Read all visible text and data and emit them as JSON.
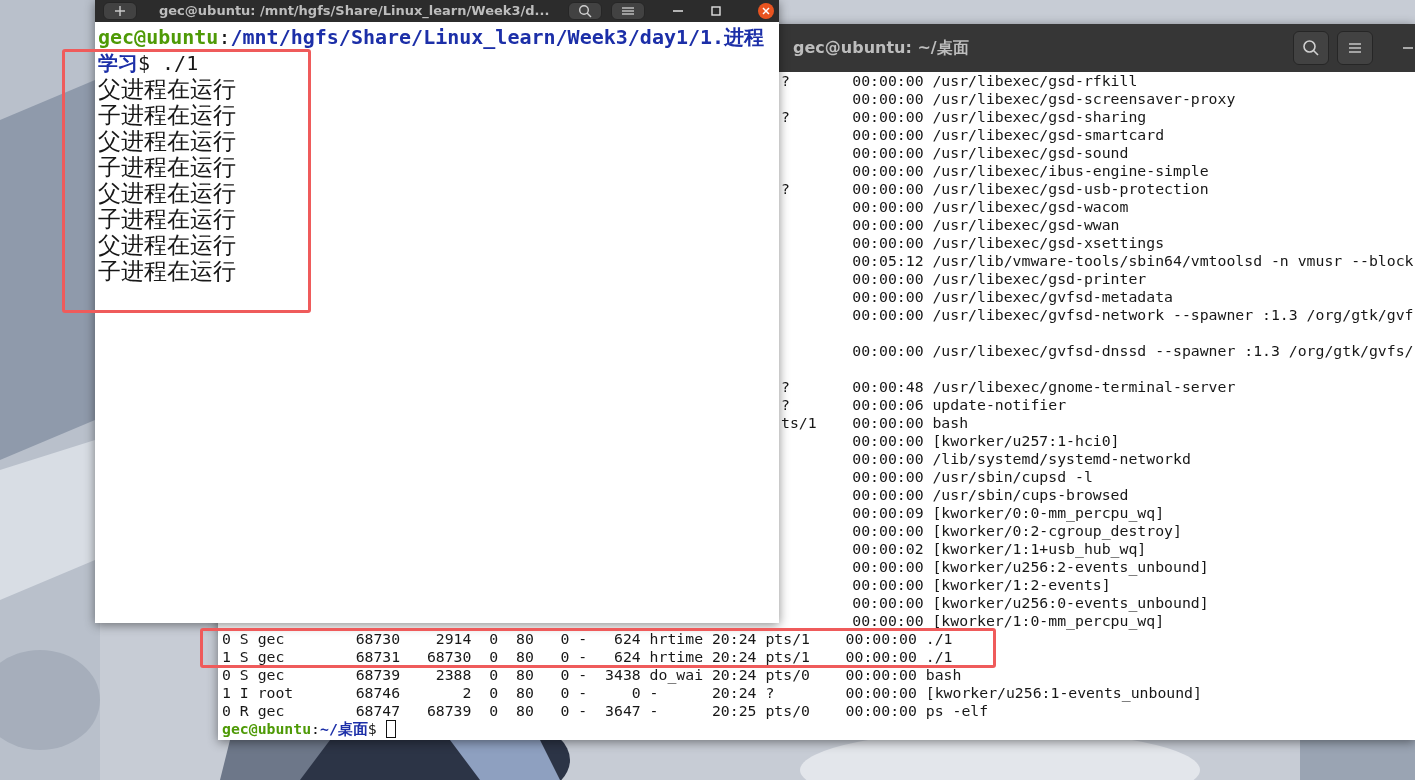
{
  "front_terminal": {
    "title": "gec@ubuntu: /mnt/hgfs/Share/Linux_learn/Week3/d...",
    "prompt": {
      "user": "gec@ubuntu",
      "separator": ":",
      "path": "/mnt/hgfs/Share/Linux_learn/Week3/day1/1.进程学习",
      "command": "$ ./1"
    },
    "output": [
      "父进程在运行",
      "子进程在运行",
      "父进程在运行",
      "子进程在运行",
      "父进程在运行",
      "子进程在运行",
      "父进程在运行",
      "子进程在运行"
    ]
  },
  "back_terminal": {
    "title": "gec@ubuntu: ~/桌面",
    "lines": [
      {
        "kind": "partial",
        "tty": "?",
        "time": "00:00:00",
        "command": "/usr/libexec/gsd-rfkill"
      },
      {
        "kind": "partial",
        "time": "00:00:00",
        "command": "/usr/libexec/gsd-screensaver-proxy"
      },
      {
        "kind": "partial",
        "tty": "?",
        "time": "00:00:00",
        "command": "/usr/libexec/gsd-sharing"
      },
      {
        "kind": "partial",
        "time": "00:00:00",
        "command": "/usr/libexec/gsd-smartcard"
      },
      {
        "kind": "partial",
        "time": "00:00:00",
        "command": "/usr/libexec/gsd-sound"
      },
      {
        "kind": "partial",
        "time": "00:00:00",
        "command": "/usr/libexec/ibus-engine-simple"
      },
      {
        "kind": "partial",
        "tty": "?",
        "time": "00:00:00",
        "command": "/usr/libexec/gsd-usb-protection"
      },
      {
        "kind": "partial",
        "time": "00:00:00",
        "command": "/usr/libexec/gsd-wacom"
      },
      {
        "kind": "partial",
        "time": "00:00:00",
        "command": "/usr/libexec/gsd-wwan"
      },
      {
        "kind": "partial",
        "time": "00:00:00",
        "command": "/usr/libexec/gsd-xsettings"
      },
      {
        "kind": "partial",
        "time": "00:05:12",
        "command": "/usr/lib/vmware-tools/sbin64/vmtoolsd -n vmusr --block"
      },
      {
        "kind": "partial",
        "time": "00:00:00",
        "command": "/usr/libexec/gsd-printer"
      },
      {
        "kind": "partial",
        "time": "00:00:00",
        "command": "/usr/libexec/gvfsd-metadata"
      },
      {
        "kind": "partial",
        "time": "00:00:00",
        "command": "/usr/libexec/gvfsd-network --spawner :1.3 /org/gtk/gvf"
      },
      {
        "kind": "blank"
      },
      {
        "kind": "partial",
        "time": "00:00:00",
        "command": "/usr/libexec/gvfsd-dnssd --spawner :1.3 /org/gtk/gvfs/"
      },
      {
        "kind": "blank"
      },
      {
        "kind": "partial",
        "tty": "?",
        "time": "00:00:48",
        "command": "/usr/libexec/gnome-terminal-server"
      },
      {
        "kind": "partial",
        "tty": "?",
        "time": "00:00:06",
        "command": "update-notifier"
      },
      {
        "kind": "partial",
        "tty": "ts/1",
        "time": "00:00:00",
        "command": "bash"
      },
      {
        "kind": "partial",
        "time": "00:00:00",
        "command": "[kworker/u257:1-hci0]"
      },
      {
        "kind": "partial",
        "time": "00:00:00",
        "command": "/lib/systemd/systemd-networkd"
      },
      {
        "kind": "partial",
        "time": "00:00:00",
        "command": "/usr/sbin/cupsd -l"
      },
      {
        "kind": "partial",
        "time": "00:00:00",
        "command": "/usr/sbin/cups-browsed"
      },
      {
        "kind": "partial",
        "time": "00:00:09",
        "command": "[kworker/0:0-mm_percpu_wq]"
      },
      {
        "kind": "partial",
        "time": "00:00:00",
        "command": "[kworker/0:2-cgroup_destroy]"
      },
      {
        "kind": "partial",
        "time": "00:00:02",
        "command": "[kworker/1:1+usb_hub_wq]"
      },
      {
        "kind": "partial",
        "time": "00:00:00",
        "command": "[kworker/u256:2-events_unbound]"
      },
      {
        "kind": "partial",
        "time": "00:00:00",
        "command": "[kworker/1:2-events]"
      },
      {
        "kind": "partial",
        "time": "00:00:00",
        "command": "[kworker/u256:0-events_unbound]"
      },
      {
        "kind": "partial",
        "time": "00:00:00",
        "command": "[kworker/1:0-mm_percpu_wq]"
      },
      {
        "kind": "full",
        "text": "0 S gec        68730    2914  0  80   0 -   624 hrtime 20:24 pts/1    00:00:00 ./1"
      },
      {
        "kind": "full",
        "text": "1 S gec        68731   68730  0  80   0 -   624 hrtime 20:24 pts/1    00:00:00 ./1"
      },
      {
        "kind": "full",
        "text": "0 S gec        68739    2388  0  80   0 -  3438 do_wai 20:24 pts/0    00:00:00 bash"
      },
      {
        "kind": "full",
        "text": "1 I root       68746       2  0  80   0 -     0 -      20:24 ?        00:00:00 [kworker/u256:1-events_unbound]"
      },
      {
        "kind": "full",
        "text": "0 R gec        68747   68739  0  80   0 -  3647 -      20:25 pts/0    00:00:00 ps -elf"
      }
    ],
    "prompt": {
      "user": "gec@ubuntu",
      "separator": ":",
      "path": "~/桌面",
      "command": "$"
    }
  }
}
